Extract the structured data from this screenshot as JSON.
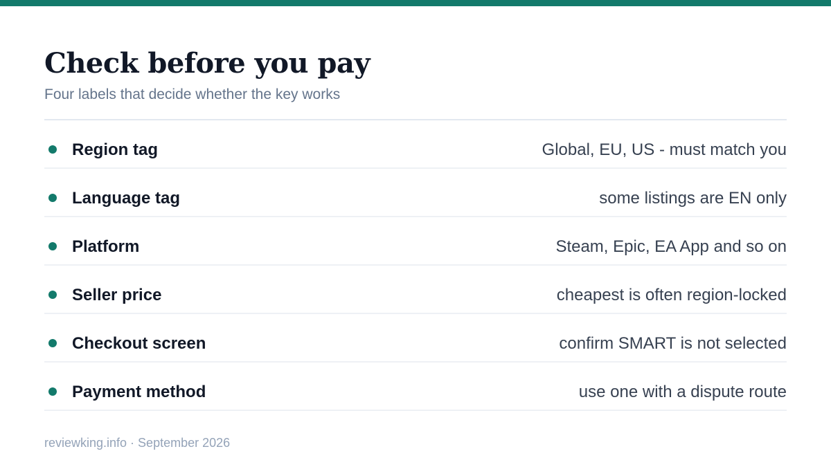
{
  "colors": {
    "accent": "#137a6b",
    "title": "#111827",
    "subtitle": "#64748b",
    "footer": "#94a3b8",
    "divider": "#e2e8f0"
  },
  "header": {
    "title": "Check before you pay",
    "subtitle": "Four labels that decide whether the key works"
  },
  "checklist": [
    {
      "label": "Region tag",
      "note": "Global, EU, US - must match you"
    },
    {
      "label": "Language tag",
      "note": "some listings are EN only"
    },
    {
      "label": "Platform",
      "note": "Steam, Epic, EA App and so on"
    },
    {
      "label": "Seller price",
      "note": "cheapest is often region-locked"
    },
    {
      "label": "Checkout screen",
      "note": "confirm SMART is not selected"
    },
    {
      "label": "Payment method",
      "note": "use one with a dispute route"
    }
  ],
  "footer": {
    "text": "reviewking.info · September 2026"
  }
}
